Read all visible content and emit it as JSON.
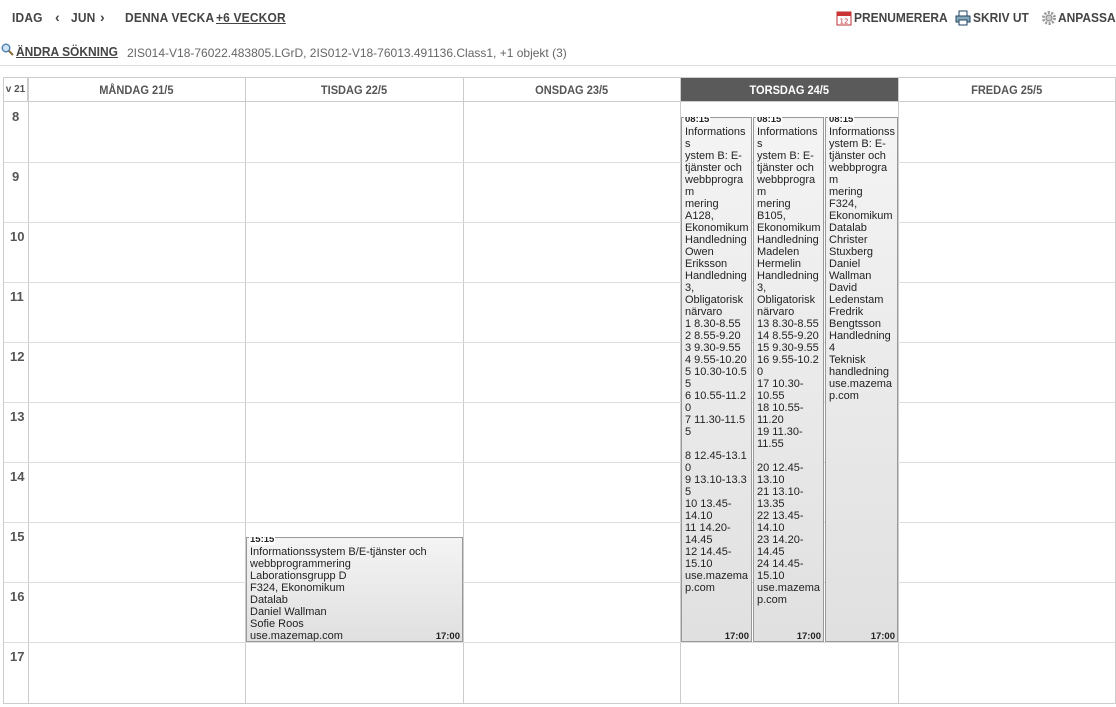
{
  "nav": {
    "today": "IDAG",
    "month": "JUN",
    "this_week": "DENNA VECKA",
    "plus_weeks": "+6 VECKOR"
  },
  "tools": {
    "subscribe": "PRENUMERERA",
    "print": "SKRIV UT",
    "customize": "ANPASSA"
  },
  "search": {
    "change_label": "ÄNDRA SÖKNING",
    "summary": "2IS014-V18-76022.483805.LGrD, 2IS012-V18-76013.491136.Class1, +1 objekt (3)"
  },
  "calendar": {
    "week_label": "v 21",
    "days": [
      "MÅNDAG 21/5",
      "TISDAG 22/5",
      "ONSDAG 23/5",
      "TORSDAG 24/5",
      "FREDAG 25/5"
    ],
    "active_day": "TORSDAG 24/5",
    "hours": [
      "8",
      "9",
      "10",
      "11",
      "12",
      "13",
      "14",
      "15",
      "16",
      "17"
    ]
  },
  "events": [
    {
      "start": "15:15",
      "end": "17:00",
      "text": "Informationssystem B/E-tjänster och\nwebbprogrammering\nLaborationsgrupp D\nF324, Ekonomikum\nDatalab\nDaniel Wallman\nSofie Roos\nuse.mazemap.com"
    },
    {
      "start": "08:15",
      "end": "17:00",
      "text": "Informationss\nystem B: E-\ntjänster och\nwebbprogram\nmering\nA128,\nEkonomikum\nHandledning\nOwen\nEriksson\nHandledning\n3,\nObligatorisk\nnärvaro\n1 8.30-8.55\n2 8.55-9.20\n3 9.30-9.55\n4 9.55-10.20\n5 10.30-10.55\n6 10.55-11.20\n7 11.30-11.55\n\n8 12.45-13.10\n9 13.10-13.35\n10 13.45-\n14.10\n11 14.20-\n14.45\n12 14.45-\n15.10\nuse.mazema\np.com"
    },
    {
      "start": "08:15",
      "end": "17:00",
      "text": "Informationss\nystem B: E-\ntjänster och\nwebbprogram\nmering\nB105,\nEkonomikum\nHandledning\nMadelen\nHermelin\nHandledning\n3,\nObligatorisk\nnärvaro\n13 8.30-8.55\n14 8.55-9.20\n15 9.30-9.55\n16 9.55-10.20\n17 10.30-\n10.55\n18 10.55-\n11.20\n19 11.30-\n11.55\n\n20 12.45-\n13.10\n21 13.10-\n13.35\n22 13.45-\n14.10\n23 14.20-\n14.45\n24 14.45-\n15.10\nuse.mazema\np.com"
    },
    {
      "start": "08:15",
      "end": "17:00",
      "text": "Informationss\nystem B: E-\ntjänster och\nwebbprogram\nmering\nF324,\nEkonomikum\nDatalab\nChrister\nStuxberg\nDaniel\nWallman\nDavid\nLedenstam\nFredrik\nBengtsson\nHandledning\n4\nTeknisk\nhandledning\nuse.mazema\np.com"
    }
  ]
}
